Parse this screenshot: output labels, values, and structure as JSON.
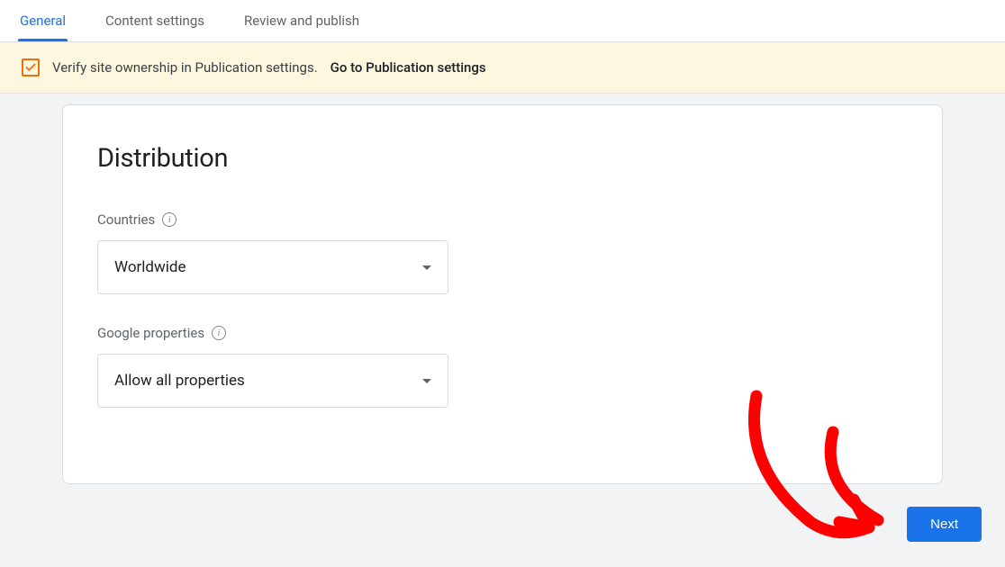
{
  "tabs": [
    {
      "label": "General",
      "active": true
    },
    {
      "label": "Content settings",
      "active": false
    },
    {
      "label": "Review and publish",
      "active": false
    }
  ],
  "banner": {
    "text": "Verify site ownership in Publication settings.",
    "link": "Go to Publication settings"
  },
  "card": {
    "title": "Distribution",
    "fields": {
      "countries": {
        "label": "Countries",
        "value": "Worldwide"
      },
      "google_properties": {
        "label": "Google properties",
        "value": "Allow all properties"
      }
    }
  },
  "actions": {
    "next": "Next"
  }
}
